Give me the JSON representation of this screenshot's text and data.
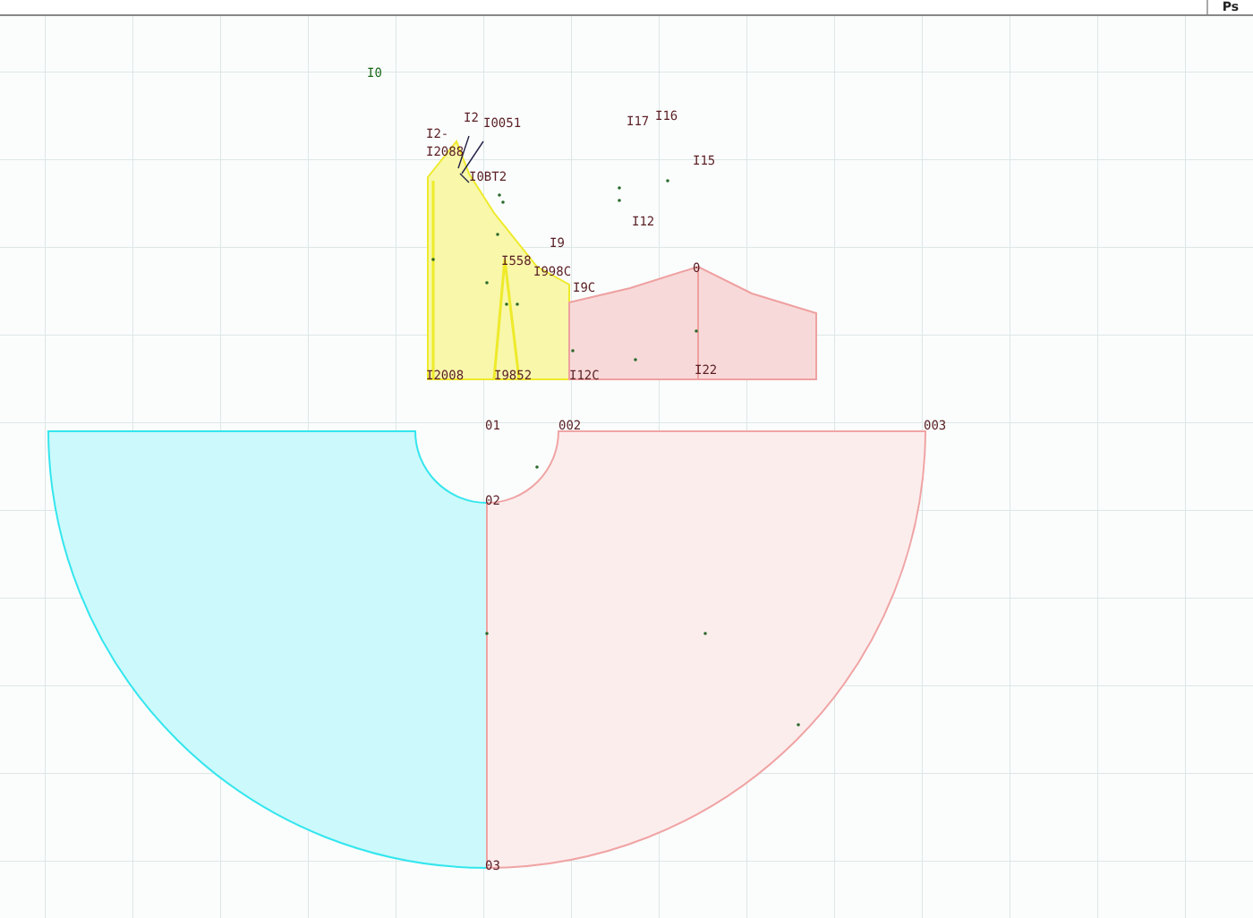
{
  "toolbar": {
    "button": "Ps"
  },
  "pieces": [
    {
      "kind": "skirt-left",
      "color": "#33e6ee"
    },
    {
      "kind": "skirt-right",
      "color": "#f0a4a4"
    },
    {
      "kind": "bodice",
      "color": "#eeea2a"
    },
    {
      "kind": "sleeve",
      "color": "#eea0a0"
    }
  ],
  "labels": [
    {
      "text": "I0"
    },
    {
      "text": "I2"
    },
    {
      "text": "I0051"
    },
    {
      "text": "I2-"
    },
    {
      "text": "I2088"
    },
    {
      "text": "I0BT2"
    },
    {
      "text": "I17"
    },
    {
      "text": "I16"
    },
    {
      "text": "I15"
    },
    {
      "text": "I12"
    },
    {
      "text": "I9"
    },
    {
      "text": "I558"
    },
    {
      "text": "I998C"
    },
    {
      "text": "I9C"
    },
    {
      "text": "0"
    },
    {
      "text": "I2008"
    },
    {
      "text": "I9852"
    },
    {
      "text": "I12C"
    },
    {
      "text": "I22"
    },
    {
      "text": "01"
    },
    {
      "text": "002"
    },
    {
      "text": "003"
    },
    {
      "text": "02"
    },
    {
      "text": "03"
    }
  ]
}
